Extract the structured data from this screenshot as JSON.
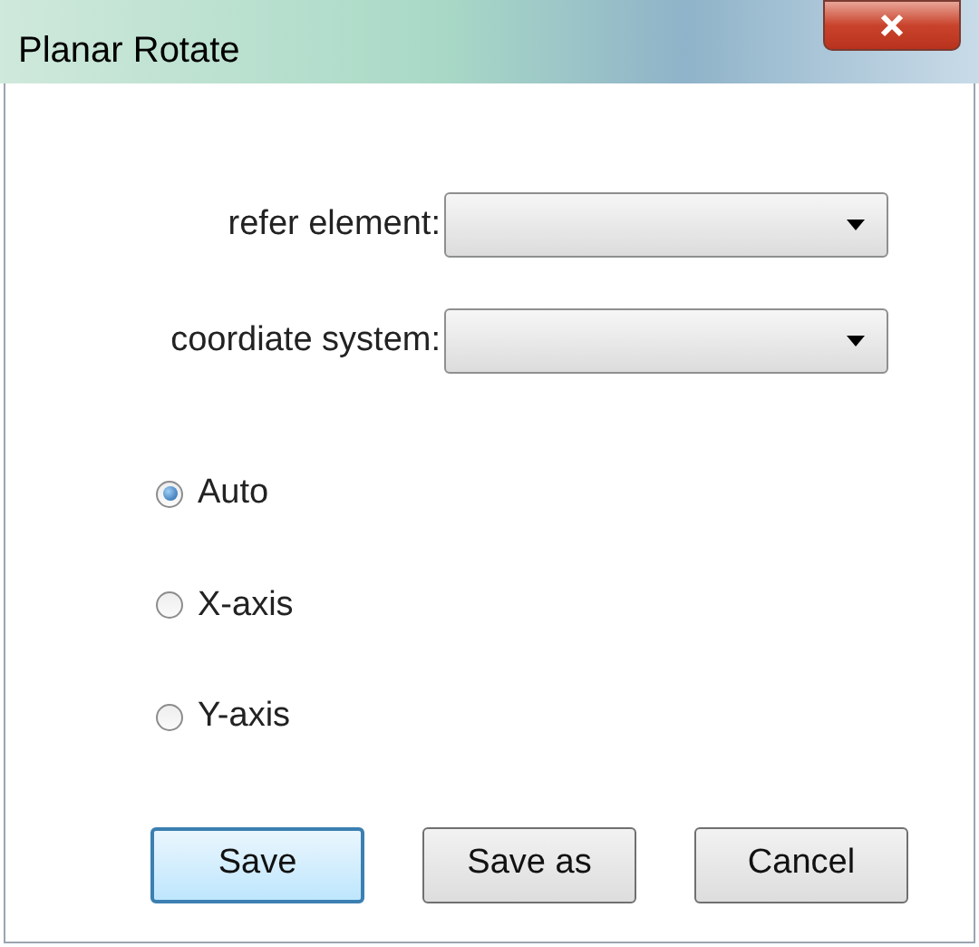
{
  "window": {
    "title": "Planar Rotate"
  },
  "fields": [
    {
      "label": "refer element:"
    },
    {
      "label": "coordiate system:"
    }
  ],
  "radios": [
    {
      "label": "Auto",
      "selected": true
    },
    {
      "label": "X-axis",
      "selected": false
    },
    {
      "label": "Y-axis",
      "selected": false
    }
  ],
  "buttons": [
    {
      "label": "Save",
      "default": true
    },
    {
      "label": "Save as",
      "default": false
    },
    {
      "label": "Cancel",
      "default": false
    }
  ]
}
